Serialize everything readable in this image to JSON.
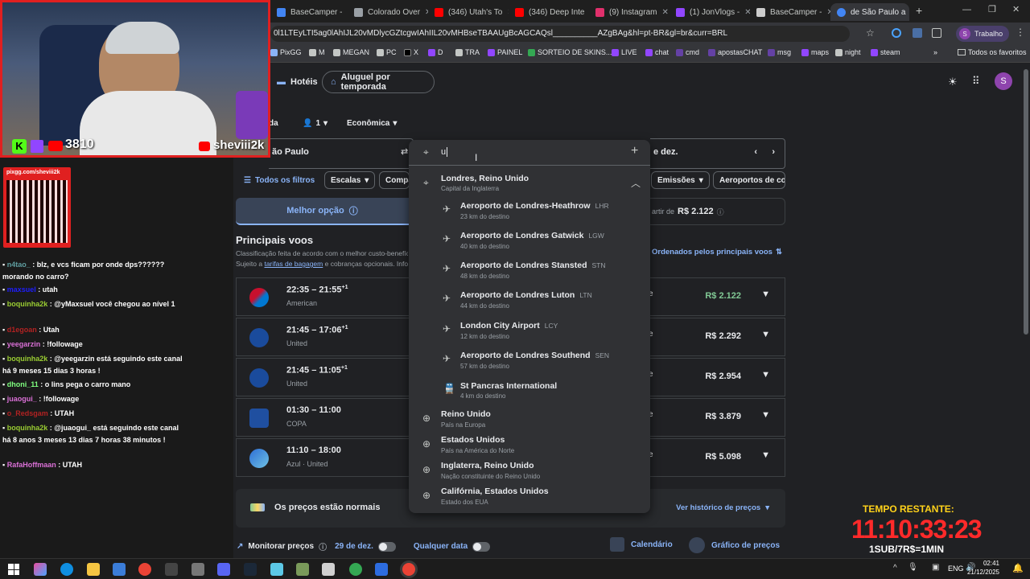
{
  "browser": {
    "tabs": [
      {
        "label": "BaseCamper -",
        "color": "#4285f4"
      },
      {
        "label": "Colorado Over",
        "color": "#9aa0a6"
      },
      {
        "label": "(346) Utah's To",
        "color": "#ff0000"
      },
      {
        "label": "(346) Deep Inte",
        "color": "#ff0000"
      },
      {
        "label": "(9) Instagram",
        "color": "#e1306c"
      },
      {
        "label": "(1) JonVlogs -",
        "color": "#9146ff"
      },
      {
        "label": "BaseCamper -",
        "color": "#cccccc"
      },
      {
        "label": "de São Paulo a",
        "color": "#4285f4"
      }
    ],
    "new_tab": "+",
    "url": "0l1LTEyLTI5ag0lAhIJL20vMDlycGZtcgwIAhIIL20vMHBseTBAAUgBcAGCAQsl__________AZgBAg&hl=pt-BR&gl=br&curr=BRL",
    "profile_label": "Trabalho",
    "profile_initial": "S",
    "bookmarks": [
      "PixGG",
      "M",
      "MEGAN",
      "PC",
      "X",
      "D",
      "TRA",
      "PAINEL",
      "SORTEIO DE SKINS...",
      "LIVE",
      "chat",
      "cmd",
      "apostasCHAT",
      "msg",
      "maps",
      "night",
      "steam"
    ],
    "all_favorites": "Todos os favoritos"
  },
  "page": {
    "nav": {
      "hotels": "Hotéis",
      "rentals": "Aluguel por temporada"
    },
    "trip": {
      "type_fragment": "da",
      "passengers": "1",
      "cabin": "Econômica"
    },
    "origin": "ão Paulo",
    "search_value": "u",
    "date_fragment": "e dez.",
    "filters": [
      "Todos os filtros",
      "Escalas",
      "Compa",
      "Emissões",
      "Aeroportos de con"
    ],
    "tabs": {
      "best": "Melhor opção",
      "from_price_prefix": "artir de",
      "from_price": "R$ 2.122"
    },
    "section_title": "Principais voos",
    "section_desc_1": "Classificação feita de acordo com o melhor custo-benefíc",
    "section_desc_2a": "Sujeito a",
    "section_desc_link": "tarifas de bagagem",
    "section_desc_2b": "e cobranças opcionais. Infor",
    "sort_label": "Ordenados pelos principais voos",
    "flights": [
      {
        "time": "22:35 – 21:55",
        "plus": "+1",
        "airline": "American",
        "mini": "e",
        "price": "R$ 2.122",
        "green": true
      },
      {
        "time": "21:45 – 17:06",
        "plus": "+1",
        "airline": "United",
        "mini": "e",
        "price": "R$ 2.292",
        "green": false
      },
      {
        "time": "21:45 – 11:05",
        "plus": "+1",
        "airline": "United",
        "mini": "e",
        "price": "R$ 2.954",
        "green": false
      },
      {
        "time": "01:30 – 11:00",
        "plus": "",
        "airline": "COPA",
        "mini": "e",
        "price": "R$ 3.879",
        "green": false
      },
      {
        "time": "11:10 – 18:00",
        "plus": "",
        "airline": "Azul · United",
        "mini": "e",
        "price": "R$ 5.098",
        "green": false
      }
    ],
    "prices_normal": "Os preços estão normais",
    "price_history": "Ver histórico de preços",
    "monitor": "Monitorar preços",
    "monitor_date": "29 de dez.",
    "any_date": "Qualquer data",
    "calendar": "Calendário",
    "price_chart": "Gráfico de preços"
  },
  "dropdown": {
    "city": {
      "name": "Londres, Reino Unido",
      "sub": "Capital da Inglaterra"
    },
    "airports": [
      {
        "name": "Aeroporto de Londres-Heathrow",
        "code": "LHR",
        "dist": "23 km do destino",
        "icon": "plane"
      },
      {
        "name": "Aeroporto de Londres Gatwick",
        "code": "LGW",
        "dist": "40 km do destino",
        "icon": "plane"
      },
      {
        "name": "Aeroporto de Londres Stansted",
        "code": "STN",
        "dist": "48 km do destino",
        "icon": "plane"
      },
      {
        "name": "Aeroporto de Londres Luton",
        "code": "LTN",
        "dist": "44 km do destino",
        "icon": "plane"
      },
      {
        "name": "London City Airport",
        "code": "LCY",
        "dist": "12 km do destino",
        "icon": "plane"
      },
      {
        "name": "Aeroporto de Londres Southend",
        "code": "SEN",
        "dist": "57 km do destino",
        "icon": "plane"
      },
      {
        "name": "St Pancras International",
        "code": "",
        "dist": "4 km do destino",
        "icon": "train"
      }
    ],
    "others": [
      {
        "name": "Reino Unido",
        "sub": "País na Europa"
      },
      {
        "name": "Estados Unidos",
        "sub": "País na América do Norte"
      },
      {
        "name": "Inglaterra, Reino Unido",
        "sub": "Nação constituinte do Reino Unido"
      },
      {
        "name": "Califórnia, Estados Unidos",
        "sub": "Estado dos EUA"
      }
    ]
  },
  "stream": {
    "viewers": "3810",
    "channel": "sheviii2k",
    "qr_url": "pixgg.com/sheviii2k",
    "chat": [
      {
        "user": "n4tao_",
        "ucolor": "#5f9ea0",
        "msg": ": blz, e vcs ficam por onde dps?????? morando no carro?"
      },
      {
        "user": "maxsuel",
        "ucolor": "#1e1eff",
        "msg": ": utah"
      },
      {
        "user": "boquinha2k",
        "ucolor": "#9acd32",
        "msg": ": @yMaxsuel você chegou ao nível 1"
      },
      {
        "user": "d1egoan",
        "ucolor": "#b22222",
        "msg": ": Utah"
      },
      {
        "user": "yeegarzin",
        "ucolor": "#da70d6",
        "msg": ": !followage"
      },
      {
        "user": "boquinha2k",
        "ucolor": "#9acd32",
        "msg": ": @yeegarzin está seguindo este canal há 9 meses 15 dias 3 horas !"
      },
      {
        "user": "dhoni_11",
        "ucolor": "#7fff7f",
        "msg": ": o lins pega o carro mano"
      },
      {
        "user": "juaogui_",
        "ucolor": "#da70d6",
        "msg": ": !followage"
      },
      {
        "user": "o_Redsgam",
        "ucolor": "#b22222",
        "msg": ": UTAH"
      },
      {
        "user": "boquinha2k",
        "ucolor": "#9acd32",
        "msg": ": @juaogui_ está seguindo este canal há 8 anos 3 meses 13 dias 7 horas 38 minutos !"
      },
      {
        "user": "RafaHoffmaan",
        "ucolor": "#da70d6",
        "msg": ": UTAH"
      }
    ],
    "timer_label": "TEMPO RESTANTE:",
    "timer_value": "11:10:33:23",
    "timer_sub": "1SUB/7R$=1MIN"
  },
  "taskbar": {
    "lang": "ENG",
    "time": "02:41",
    "date": "21/12/2025"
  },
  "colors": {
    "accent": "#8ab4f8",
    "green_price": "#81c995",
    "timer_red": "#ff2a2a",
    "timer_yellow": "#ffd21a"
  }
}
